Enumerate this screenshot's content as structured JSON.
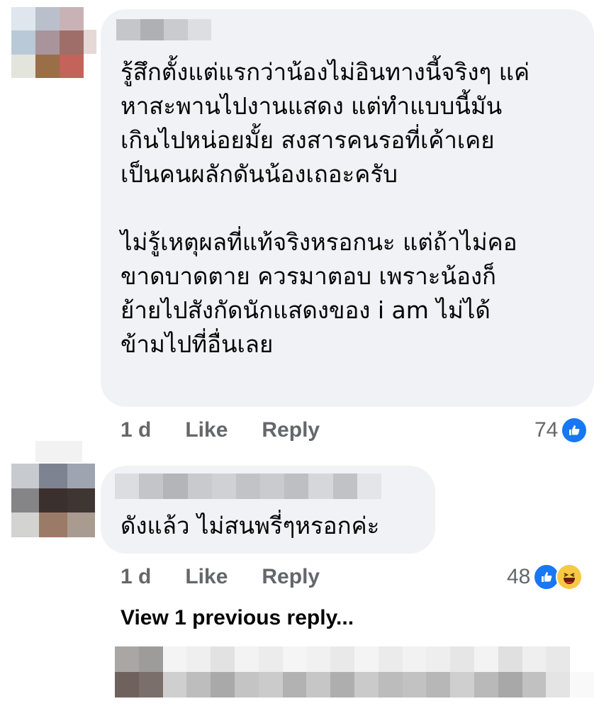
{
  "comments": [
    {
      "author": "",
      "text": "รู้สึกตั้งแต่แรกว่าน้องไม่อินทางนี้จริงๆ แค่\nหาสะพานไปงานแสดง  แต่ทำแบบนี้มัน\nเกินไปหน่อยมั้ย  สงสารคนรอที่เค้าเคย\nเป็นคนผลักดันน้องเถอะครับ\n\nไม่รู้เหตุผลที่แท้จริงหรอกนะ  แต่ถ้าไม่คอ\nขาดบาดตาย  ควรมาตอบ  เพราะน้องก็\nย้ายไปสังกัดนักแสดงของ i am  ไม่ได้\nข้ามไปที่อื่นเลย",
      "time": "1 d",
      "like_label": "Like",
      "reply_label": "Reply",
      "reaction_count": "74",
      "reactions": [
        "like-icon"
      ]
    },
    {
      "author": "",
      "text": "ดังแล้ว ไม่สนพรี่ๆหรอกค่ะ",
      "time": "1 d",
      "like_label": "Like",
      "reply_label": "Reply",
      "reaction_count": "48",
      "reactions": [
        "like-icon",
        "haha-icon"
      ]
    }
  ],
  "view_previous_replies": "View 1 previous reply...",
  "colors": {
    "bubble": "#f0f2f5",
    "text": "#050505",
    "meta": "#65676b",
    "like_blue": "#1877f2",
    "haha_yellow": "#f7c844"
  }
}
